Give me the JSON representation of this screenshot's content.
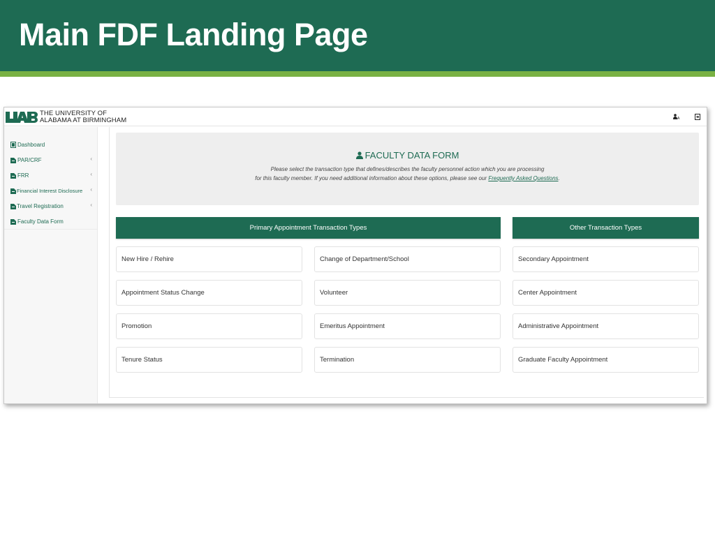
{
  "slide": {
    "title": "Main FDF Landing Page",
    "colors": {
      "header": "#1e6b53",
      "accent_bar": "#79b143"
    }
  },
  "app": {
    "logo_text_line1": "THE UNIVERSITY OF",
    "logo_text_line2": "ALABAMA AT BIRMINGHAM",
    "logo_mark": "UAB",
    "top_icons": [
      "user-settings-icon",
      "logout-icon"
    ]
  },
  "sidebar": {
    "items": [
      {
        "label": "Dashboard",
        "icon": "file-icon",
        "has_submenu": false
      },
      {
        "label": "PAR/CRF",
        "icon": "file-icon",
        "has_submenu": true
      },
      {
        "label": "FRR",
        "icon": "file-icon",
        "has_submenu": true
      },
      {
        "label": "Financial Interest Disclosure",
        "icon": "file-icon",
        "has_submenu": true
      },
      {
        "label": "Travel Registration",
        "icon": "file-icon",
        "has_submenu": true
      },
      {
        "label": "Faculty Data Form",
        "icon": "file-icon",
        "has_submenu": false
      }
    ],
    "chevron": "‹"
  },
  "hero": {
    "title": "FACULTY DATA FORM",
    "icon": "user-icon",
    "desc_line1": "Please select the transaction type that defines/describes the faculty personnel action which you are processing",
    "desc_line2_prefix": "for this faculty member. If you need additional information about these options, please see our ",
    "faq_link": "Frequently Asked Questions",
    "desc_line2_suffix": "."
  },
  "primary": {
    "header": "Primary Appointment Transaction Types",
    "left": [
      "New Hire / Rehire",
      "Appointment Status Change",
      "Promotion",
      "Tenure Status"
    ],
    "right": [
      "Change of Department/School",
      "Volunteer",
      "Emeritus Appointment",
      "Termination"
    ]
  },
  "other": {
    "header": "Other Transaction Types",
    "items": [
      "Secondary Appointment",
      "Center Appointment",
      "Administrative Appointment",
      "Graduate Faculty Appointment"
    ]
  }
}
